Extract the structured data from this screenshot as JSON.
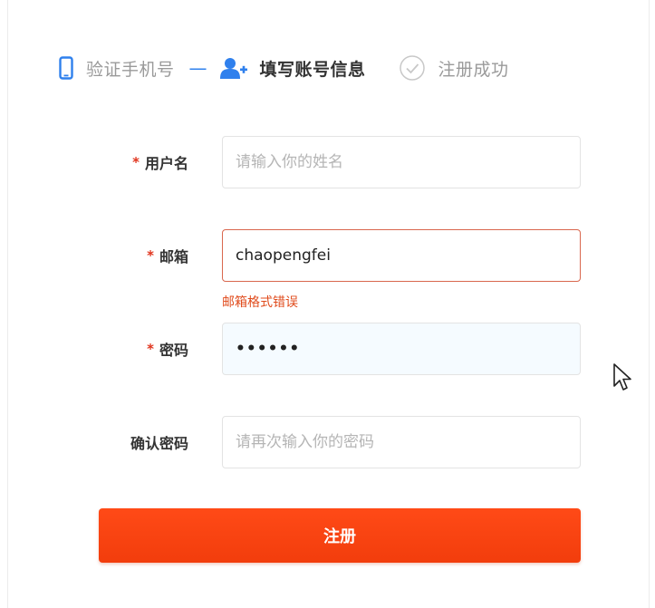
{
  "steps": {
    "step1": {
      "label": "验证手机号",
      "icon": "phone-icon"
    },
    "separator": "—",
    "step2": {
      "label": "填写账号信息",
      "icon": "add-user-icon"
    },
    "step3": {
      "label": "注册成功",
      "icon": "check-circle-icon"
    }
  },
  "form": {
    "required_mark": "*",
    "username": {
      "label": "用户名",
      "placeholder": "请输入你的姓名",
      "value": ""
    },
    "email": {
      "label": "邮箱",
      "placeholder": "",
      "value": "chaopengfei",
      "error": "邮箱格式错误"
    },
    "password": {
      "label": "密码",
      "value": "••••••"
    },
    "confirm": {
      "label": "确认密码",
      "placeholder": "请再次输入你的密码",
      "value": ""
    },
    "submit_label": "注册"
  },
  "colors": {
    "accent": "#2f80ed",
    "button": "#f54510",
    "error": "#e04b1c",
    "required": "#e0341d"
  }
}
